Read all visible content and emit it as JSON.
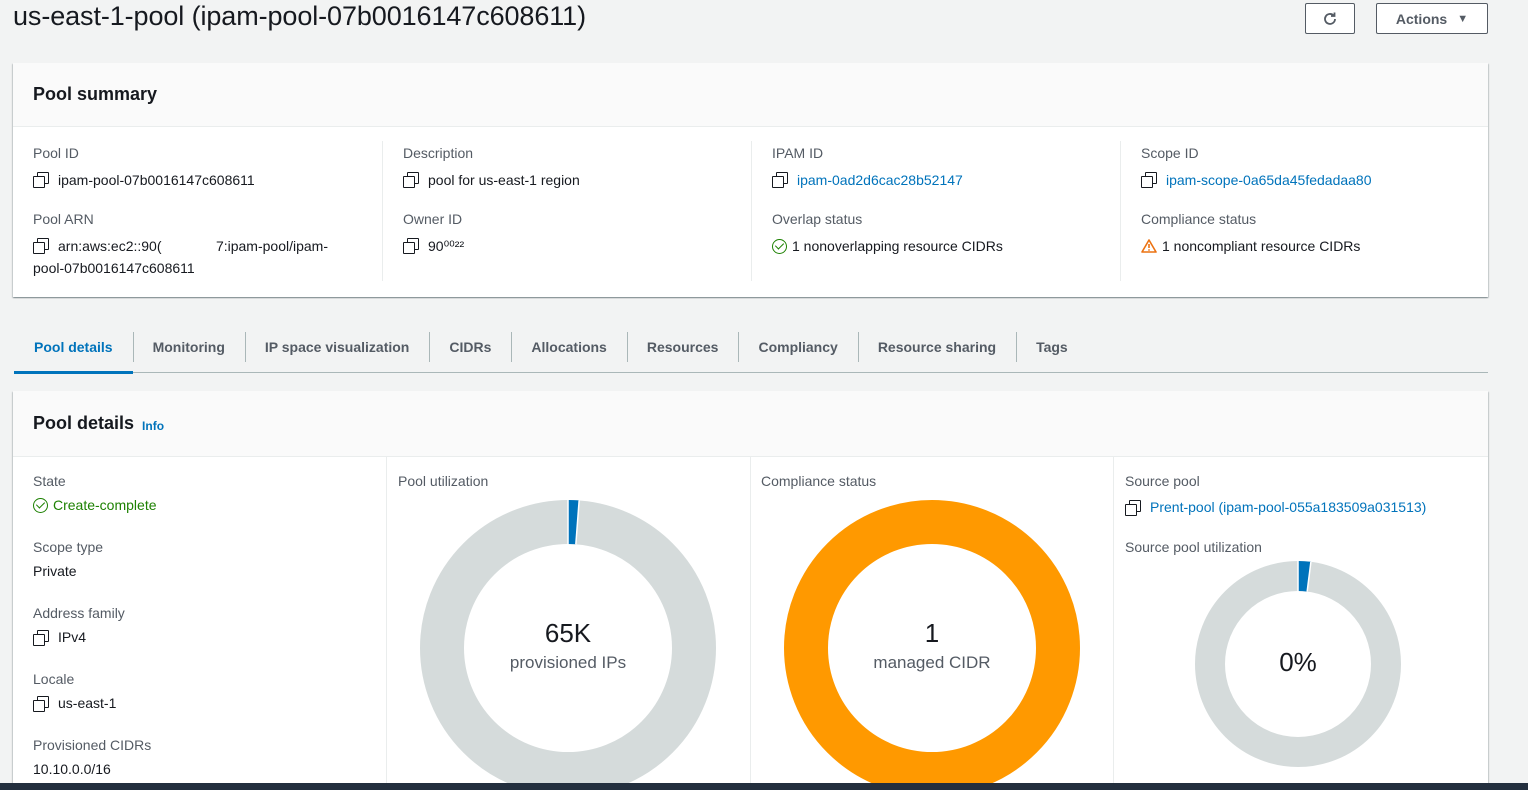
{
  "page": {
    "title": "us-east-1-pool (ipam-pool-07b0016147c608611)",
    "actions_label": "Actions"
  },
  "summary": {
    "title": "Pool summary",
    "pool_id_label": "Pool ID",
    "pool_id": "ipam-pool-07b0016147c608611",
    "pool_arn_label": "Pool ARN",
    "pool_arn_line1": "arn:aws:ec2::90(              7:ipam-pool/ipam-",
    "pool_arn_line2": "pool-07b0016147c608611",
    "description_label": "Description",
    "description": "pool for us-east-1 region",
    "owner_id_label": "Owner ID",
    "owner_id": "90⁰⁰²²",
    "ipam_id_label": "IPAM ID",
    "ipam_id": "ipam-0ad2d6cac28b52147",
    "overlap_label": "Overlap status",
    "overlap_value": "1 nonoverlapping resource CIDRs",
    "scope_id_label": "Scope ID",
    "scope_id": "ipam-scope-0a65da45fedadaa80",
    "compliance_label": "Compliance status",
    "compliance_value": "1 noncompliant resource CIDRs"
  },
  "tabs": [
    {
      "label": "Pool details",
      "active": true
    },
    {
      "label": "Monitoring"
    },
    {
      "label": "IP space visualization"
    },
    {
      "label": "CIDRs"
    },
    {
      "label": "Allocations"
    },
    {
      "label": "Resources"
    },
    {
      "label": "Compliancy"
    },
    {
      "label": "Resource sharing"
    },
    {
      "label": "Tags"
    }
  ],
  "details": {
    "title": "Pool details",
    "info": "Info",
    "state_label": "State",
    "state_value": "Create-complete",
    "scope_type_label": "Scope type",
    "scope_type": "Private",
    "address_family_label": "Address family",
    "address_family": "IPv4",
    "locale_label": "Locale",
    "locale": "us-east-1",
    "provisioned_label": "Provisioned CIDRs",
    "provisioned_value": "10.10.0.0/16",
    "pool_util_label": "Pool utilization",
    "pool_util_num": "65K",
    "pool_util_sub": "provisioned IPs",
    "pool_util_fraction": 0.012,
    "compliance_label": "Compliance status",
    "compliance_num": "1",
    "compliance_sub": "managed CIDR",
    "source_pool_label": "Source pool",
    "source_pool": "Prent-pool (ipam-pool-055a183509a031513)",
    "source_util_label": "Source pool utilization",
    "source_util_num": "0%",
    "source_util_fraction": 0.02
  },
  "colors": {
    "donut_track": "#d5dbdb",
    "donut_used": "#0073bb",
    "compliance_orange": "#ff9900",
    "link": "#0073bb",
    "success": "#1d8102",
    "warning": "#ec7211"
  }
}
